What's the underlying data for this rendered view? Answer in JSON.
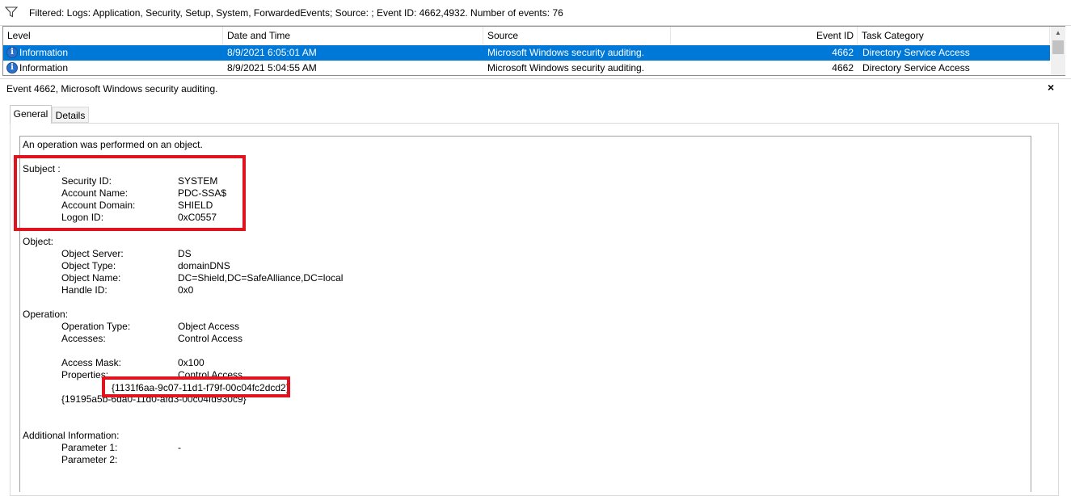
{
  "filter_bar": {
    "text": "Filtered: Logs: Application, Security, Setup, System, ForwardedEvents; Source: ; Event ID: 4662,4932. Number of events: 76",
    "icon": "funnel-icon"
  },
  "event_list": {
    "columns": [
      "Level",
      "Date and Time",
      "Source",
      "Event ID",
      "Task Category"
    ],
    "rows": [
      {
        "level": "Information",
        "datetime": "8/9/2021 6:05:01 AM",
        "source": "Microsoft Windows security auditing.",
        "event_id": "4662",
        "task_category": "Directory Service Access",
        "selected": true
      },
      {
        "level": "Information",
        "datetime": "8/9/2021 5:04:55 AM",
        "source": "Microsoft Windows security auditing.",
        "event_id": "4662",
        "task_category": "Directory Service Access",
        "selected": false
      }
    ],
    "selection_color": "#0078d7"
  },
  "details": {
    "title": "Event 4662, Microsoft Windows security auditing.",
    "close": "×",
    "tabs": [
      "General",
      "Details"
    ],
    "active_tab": "General",
    "message": {
      "intro": "An operation was performed on an object.",
      "subject_header": "Subject :",
      "subject": [
        {
          "label": "Security ID:",
          "value": "SYSTEM"
        },
        {
          "label": "Account Name:",
          "value": "PDC-SSA$"
        },
        {
          "label": "Account Domain:",
          "value": "SHIELD"
        },
        {
          "label": "Logon ID:",
          "value": "0xC0557"
        }
      ],
      "object_header": "Object:",
      "object": [
        {
          "label": "Object Server:",
          "value": "DS"
        },
        {
          "label": "Object Type:",
          "value": "domainDNS"
        },
        {
          "label": "Object Name:",
          "value": "DC=Shield,DC=SafeAlliance,DC=local"
        },
        {
          "label": "Handle ID:",
          "value": "0x0"
        }
      ],
      "operation_header": "Operation:",
      "operation": [
        {
          "label": "Operation Type:",
          "value": "Object Access"
        },
        {
          "label": "Accesses:",
          "value": "Control Access"
        }
      ],
      "access_mask": {
        "label": "Access Mask:",
        "value": "0x100"
      },
      "properties": {
        "label": "Properties:",
        "value": "Control Access"
      },
      "property_guids": [
        "{1131f6aa-9c07-11d1-f79f-00c04fc2dcd2}",
        "{19195a5b-6da0-11d0-afd3-00c04fd930c9}"
      ],
      "additional_header": "Additional Information:",
      "additional": [
        {
          "label": "Parameter 1:",
          "value": "-"
        },
        {
          "label": "Parameter 2:",
          "value": ""
        }
      ]
    },
    "highlight_color": "#e0141e"
  }
}
